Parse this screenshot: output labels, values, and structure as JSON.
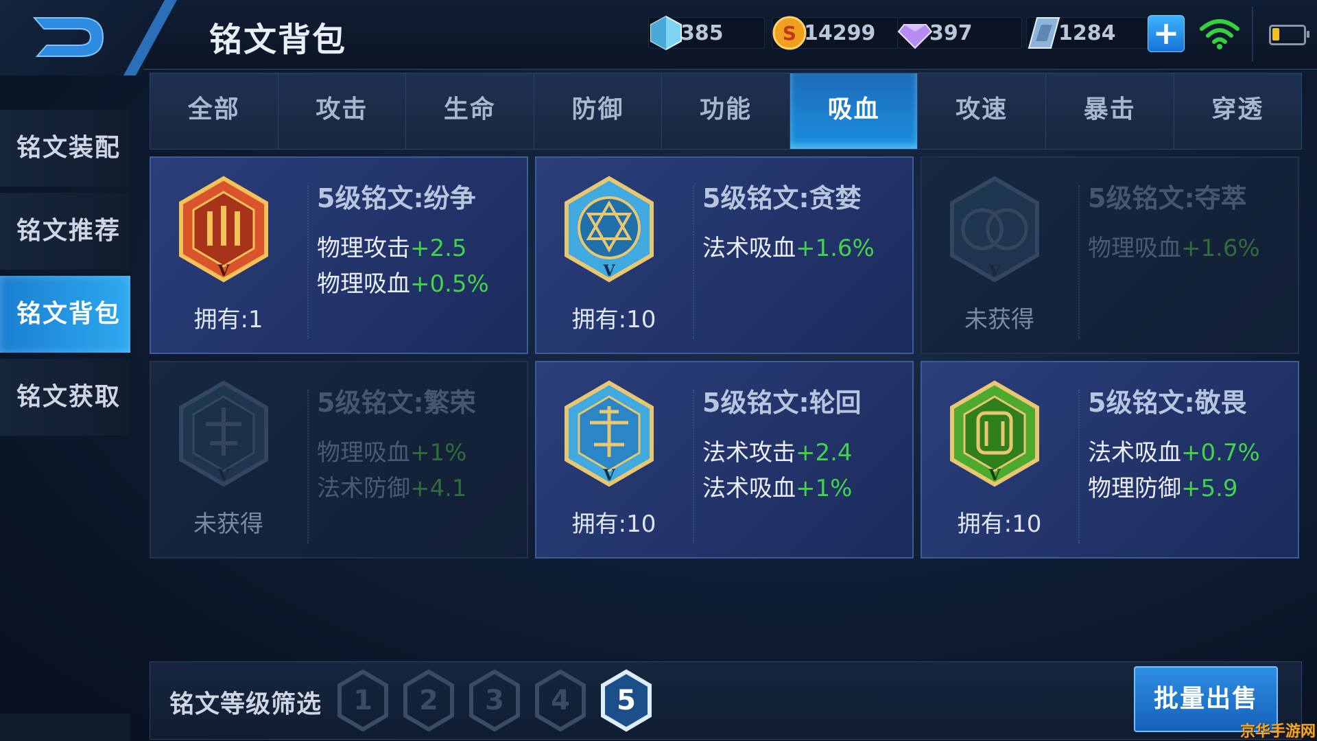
{
  "header": {
    "title": "铭文背包",
    "resources": [
      {
        "icon": "diamond-crystal-icon",
        "value": "385"
      },
      {
        "icon": "gold-coin-icon",
        "value": "14299"
      },
      {
        "icon": "gem-icon",
        "value": "397"
      },
      {
        "icon": "voucher-icon",
        "value": "1284"
      }
    ],
    "plus": "+"
  },
  "sidebar": {
    "items": [
      {
        "label": "铭文装配"
      },
      {
        "label": "铭文推荐"
      },
      {
        "label": "铭文背包"
      },
      {
        "label": "铭文获取"
      }
    ],
    "active_index": 2
  },
  "tabs": {
    "items": [
      "全部",
      "攻击",
      "生命",
      "防御",
      "功能",
      "吸血",
      "攻速",
      "暴击",
      "穿透"
    ],
    "active": "吸血"
  },
  "cards": [
    {
      "name": "5级铭文:纷争",
      "owned": "拥有:1",
      "locked": false,
      "emblem": "red-rune-emblem",
      "color": "#d9542a",
      "stats": [
        {
          "label": "物理攻击",
          "value": "+2.5"
        },
        {
          "label": "物理吸血",
          "value": "+0.5%"
        }
      ]
    },
    {
      "name": "5级铭文:贪婪",
      "owned": "拥有:10",
      "locked": false,
      "emblem": "blue-rune-emblem",
      "color": "#3fa9e0",
      "stats": [
        {
          "label": "法术吸血",
          "value": "+1.6%"
        }
      ]
    },
    {
      "name": "5级铭文:夺萃",
      "owned": "未获得",
      "locked": true,
      "emblem": "blue-rune-emblem",
      "color": "#3a5a7a",
      "stats": [
        {
          "label": "物理吸血",
          "value": "+1.6%"
        }
      ]
    },
    {
      "name": "5级铭文:繁荣",
      "owned": "未获得",
      "locked": true,
      "emblem": "blue-rune-emblem",
      "color": "#3a5a7a",
      "stats": [
        {
          "label": "物理吸血",
          "value": "+1%"
        },
        {
          "label": "法术防御",
          "value": "+4.1"
        }
      ]
    },
    {
      "name": "5级铭文:轮回",
      "owned": "拥有:10",
      "locked": false,
      "emblem": "blue-rune-emblem",
      "color": "#3fa9e0",
      "stats": [
        {
          "label": "法术攻击",
          "value": "+2.4"
        },
        {
          "label": "法术吸血",
          "value": "+1%"
        }
      ]
    },
    {
      "name": "5级铭文:敬畏",
      "owned": "拥有:10",
      "locked": false,
      "emblem": "green-rune-emblem",
      "color": "#4caa2e",
      "stats": [
        {
          "label": "法术吸血",
          "value": "+0.7%"
        },
        {
          "label": "物理防御",
          "value": "+5.9"
        }
      ]
    }
  ],
  "filter": {
    "label": "铭文等级筛选",
    "levels": [
      "1",
      "2",
      "3",
      "4",
      "5"
    ],
    "active": "5",
    "sell_button": "批量出售"
  },
  "watermark": "京华手游网"
}
